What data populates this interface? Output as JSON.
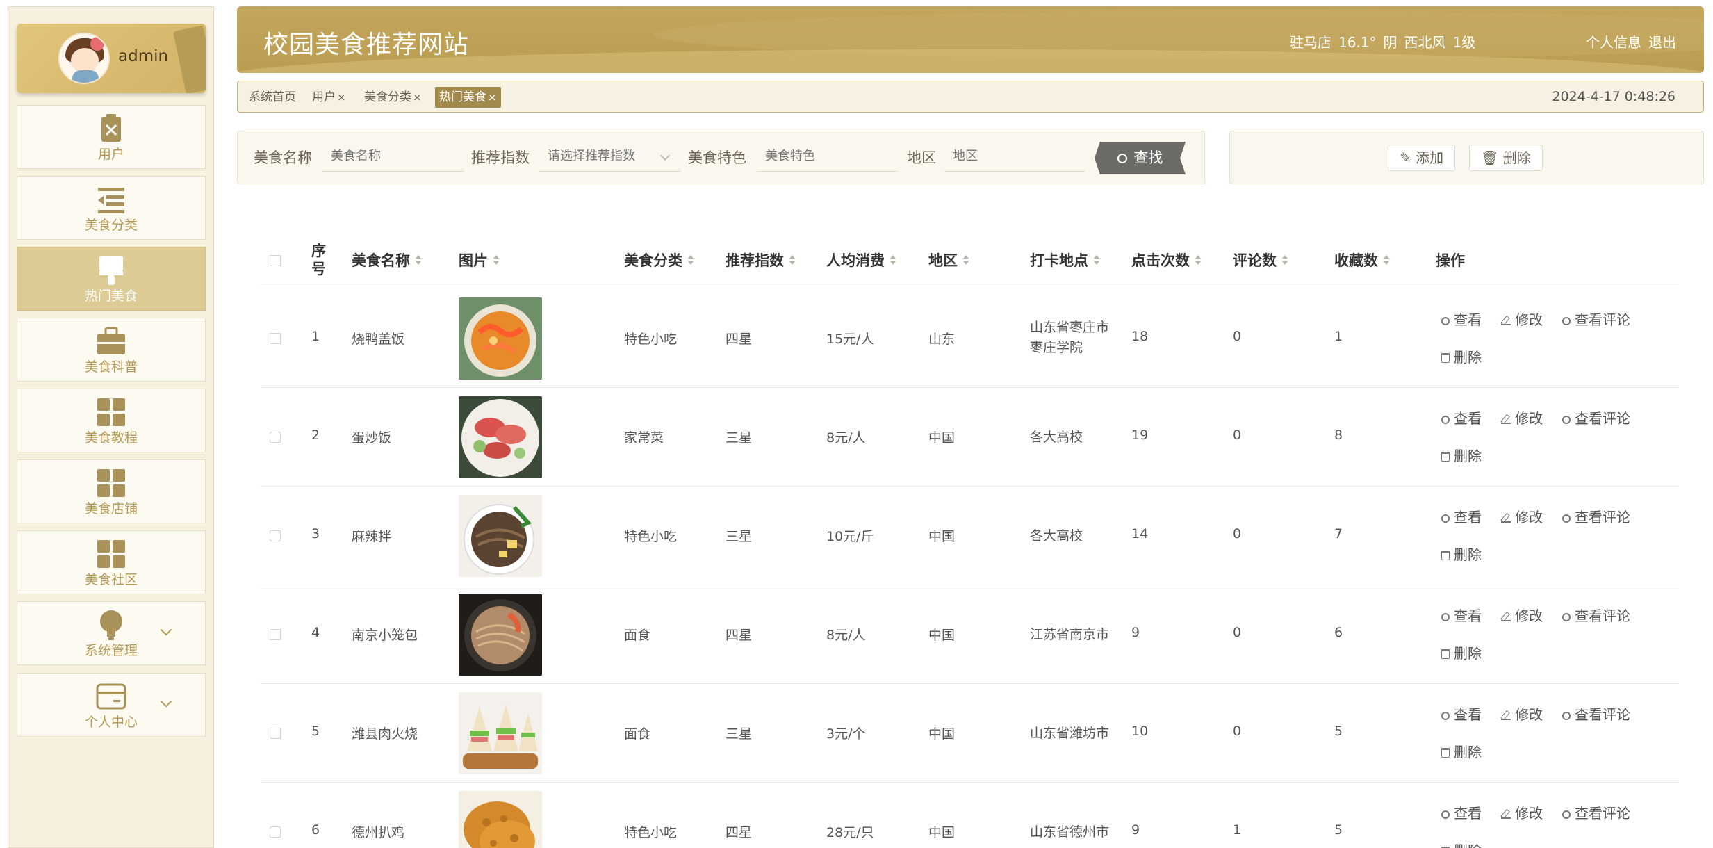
{
  "user": {
    "name": "admin"
  },
  "sidebar": {
    "items": [
      {
        "label": "用户",
        "icon": "clipboard-x-icon",
        "active": false,
        "has_chevron": false
      },
      {
        "label": "美食分类",
        "icon": "list-indent-icon",
        "active": false,
        "has_chevron": false
      },
      {
        "label": "热门美食",
        "icon": "brush-icon",
        "active": true,
        "has_chevron": false
      },
      {
        "label": "美食科普",
        "icon": "briefcase-icon",
        "active": false,
        "has_chevron": false
      },
      {
        "label": "美食教程",
        "icon": "grid-icon",
        "active": false,
        "has_chevron": false
      },
      {
        "label": "美食店铺",
        "icon": "grid-icon",
        "active": false,
        "has_chevron": false
      },
      {
        "label": "美食社区",
        "icon": "grid-icon",
        "active": false,
        "has_chevron": false
      },
      {
        "label": "系统管理",
        "icon": "lightbulb-icon",
        "active": false,
        "has_chevron": true
      },
      {
        "label": "个人中心",
        "icon": "wallet-card-icon",
        "active": false,
        "has_chevron": true
      }
    ]
  },
  "header": {
    "title": "校园美食推荐网站",
    "weather": {
      "city": "驻马店",
      "temp": "16.1°",
      "condition": "阴",
      "wind": "西北风",
      "level": "1级"
    },
    "links": {
      "profile": "个人信息",
      "logout": "退出"
    }
  },
  "tabs": {
    "items": [
      {
        "label": "系统首页",
        "closable": false,
        "active": false
      },
      {
        "label": "用户",
        "closable": true,
        "active": false
      },
      {
        "label": "美食分类",
        "closable": true,
        "active": false
      },
      {
        "label": "热门美食",
        "closable": true,
        "active": true
      }
    ],
    "close_glyph": "×",
    "datetime": "2024-4-17 0:48:26"
  },
  "search": {
    "name_label": "美食名称",
    "name_placeholder": "美食名称",
    "index_label": "推荐指数",
    "index_placeholder": "请选择推荐指数",
    "feature_label": "美食特色",
    "feature_placeholder": "美食特色",
    "region_label": "地区",
    "region_placeholder": "地区",
    "search_button": "查找"
  },
  "actions": {
    "add": "添加",
    "delete": "删除"
  },
  "table": {
    "columns": {
      "index": "序号",
      "name": "美食名称",
      "image": "图片",
      "category": "美食分类",
      "rating": "推荐指数",
      "price": "人均消费",
      "region": "地区",
      "checkin": "打卡地点",
      "clicks": "点击次数",
      "comments": "评论数",
      "favorites": "收藏数",
      "ops": "操作"
    },
    "op_labels": {
      "view": "查看",
      "edit": "修改",
      "view_comments": "查看评论",
      "delete": "删除"
    },
    "rows": [
      {
        "index": "1",
        "name": "烧鸭盖饭",
        "category": "特色小吃",
        "rating": "四星",
        "price": "15元/人",
        "region": "山东",
        "checkin": "山东省枣庄市枣庄学院",
        "clicks": "18",
        "comments": "0",
        "favorites": "1",
        "img": "soup-shrimp"
      },
      {
        "index": "2",
        "name": "蛋炒饭",
        "category": "家常菜",
        "rating": "三星",
        "price": "8元/人",
        "region": "中国",
        "checkin": "各大高校",
        "clicks": "19",
        "comments": "0",
        "favorites": "8",
        "img": "meat-salad"
      },
      {
        "index": "3",
        "name": "麻辣拌",
        "category": "特色小吃",
        "rating": "三星",
        "price": "10元/斤",
        "region": "中国",
        "checkin": "各大高校",
        "clicks": "14",
        "comments": "0",
        "favorites": "7",
        "img": "noodle-bowl"
      },
      {
        "index": "4",
        "name": "南京小笼包",
        "category": "面食",
        "rating": "四星",
        "price": "8元/人",
        "region": "中国",
        "checkin": "江苏省南京市",
        "clicks": "9",
        "comments": "0",
        "favorites": "6",
        "img": "noodle-dark"
      },
      {
        "index": "5",
        "name": "潍县肉火烧",
        "category": "面食",
        "rating": "三星",
        "price": "3元/个",
        "region": "中国",
        "checkin": "山东省潍坊市",
        "clicks": "10",
        "comments": "0",
        "favorites": "5",
        "img": "sandwich"
      },
      {
        "index": "6",
        "name": "德州扒鸡",
        "category": "特色小吃",
        "rating": "四星",
        "price": "28元/只",
        "region": "中国",
        "checkin": "山东省德州市",
        "clicks": "9",
        "comments": "1",
        "favorites": "5",
        "img": "fried-chicken"
      }
    ]
  },
  "colors": {
    "accent": "#bb9d51",
    "sidebar_bg": "#f6f1df",
    "active_nav": "#dccb95",
    "nav_text": "#b49a56",
    "active_tab": "#a18a4b",
    "search_button": "#6b6b68"
  }
}
